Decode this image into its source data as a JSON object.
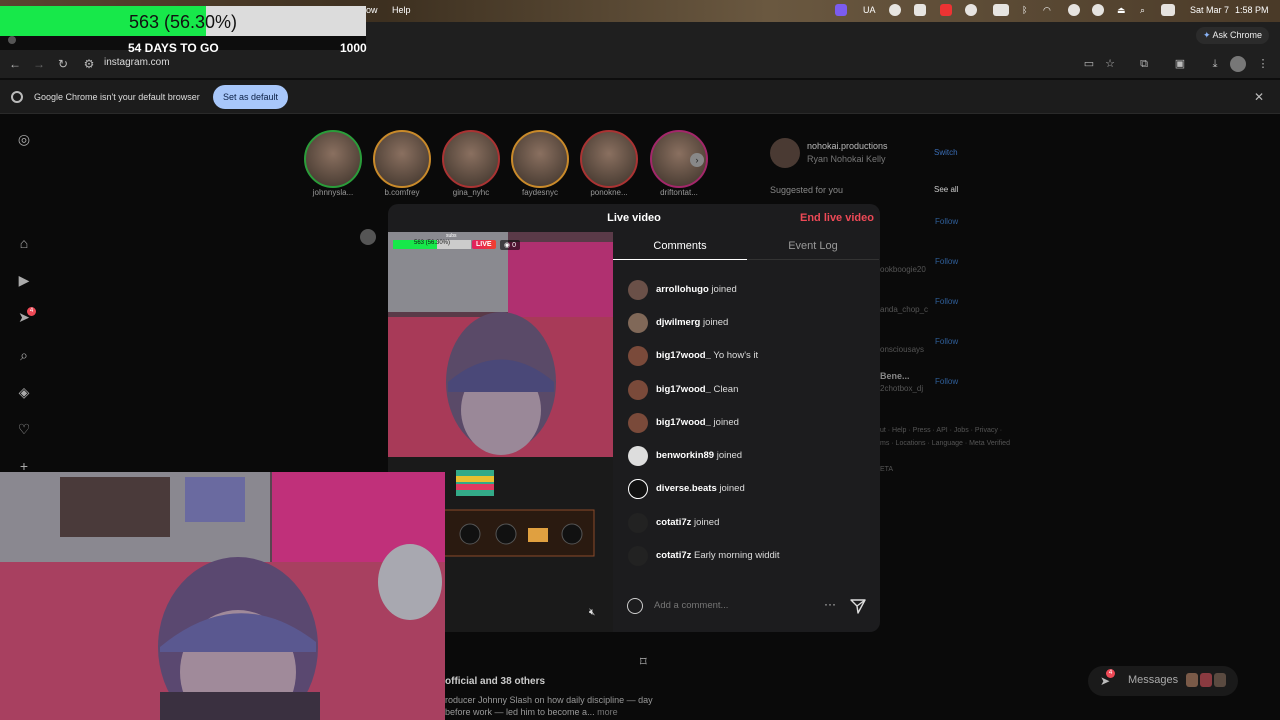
{
  "menubar": {
    "items": [
      "ow",
      "Help"
    ],
    "date": "Sat Mar 7",
    "time": "1:58 PM",
    "lang": "UA"
  },
  "overlay": {
    "goal_text": "563 (56.30%)",
    "goal_fraction": 0.563,
    "days_text": "54 DAYS TO GO",
    "goal_max": "1000"
  },
  "chrome": {
    "ask_label": "Ask Chrome",
    "url": "instagram.com",
    "infobar_text": "Google Chrome isn't your default browser",
    "set_default_label": "Set as default"
  },
  "stories": [
    {
      "name": "johnnysla..."
    },
    {
      "name": "b.comfrey"
    },
    {
      "name": "gina_nyhc"
    },
    {
      "name": "faydesnyc"
    },
    {
      "name": "ponokne..."
    },
    {
      "name": "driftontat..."
    }
  ],
  "account": {
    "username": "nohokai.productions",
    "full_name": "Ryan Nohokai Kelly",
    "switch_label": "Switch",
    "suggested_label": "Suggested for you",
    "see_all_label": "See all",
    "follow_label": "Follow"
  },
  "suggestion_handles": [
    "ookboogie20",
    "anda_chop_c",
    "onsciousays",
    "Bene...",
    "2chotbox_dj"
  ],
  "footer": {
    "links": "ut · Help · Press · API · Jobs · Privacy ·\nms · Locations · Language · Meta Verified\n\nETA"
  },
  "live": {
    "title": "Live video",
    "end_label": "End live video",
    "tabs": [
      "Comments",
      "Event Log"
    ],
    "live_badge": "LIVE",
    "viewer_count": "0",
    "mini_goal": "563 (56.30%)",
    "mini_label": "subs",
    "comment_placeholder": "Add a comment...",
    "comments": [
      {
        "user": "arrollohugo",
        "text": "joined"
      },
      {
        "user": "djwilmerg",
        "text": "joined"
      },
      {
        "user": "big17wood_",
        "text": "Yo how's it"
      },
      {
        "user": "big17wood_",
        "text": "Clean"
      },
      {
        "user": "big17wood_",
        "text": "joined"
      },
      {
        "user": "benworkin89",
        "text": "joined"
      },
      {
        "user": "diverse.beats",
        "text": "joined"
      },
      {
        "user": "cotati7z",
        "text": "joined"
      },
      {
        "user": "cotati7z",
        "text": "Early morning widdit"
      }
    ]
  },
  "post": {
    "likes": "official and 38 others",
    "caption": "roducer Johnny Slash on how daily discipline — day before work — led him to become a...",
    "more_label": "more"
  },
  "messages": {
    "label": "Messages",
    "badge": "4"
  },
  "sidebar": {
    "notif_badge": "4"
  },
  "colors": {
    "accent_red": "#ed4956",
    "goal_green": "#17e84a",
    "set_default_bg": "#a8c7fa"
  }
}
